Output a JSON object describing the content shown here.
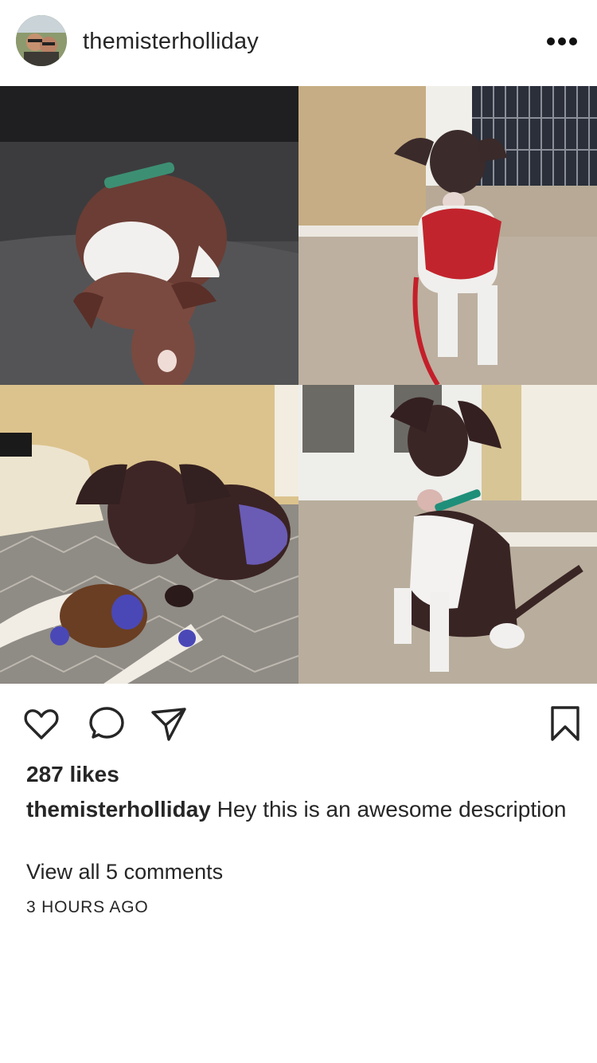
{
  "post": {
    "username": "themisterholliday",
    "more_icon": "ellipsis-icon",
    "likes_text": "287 likes",
    "caption_user": "themisterholliday",
    "caption_text": "Hey this is an awesome description",
    "view_comments_text": "View all 5 comments",
    "timestamp": "3 HOURS AGO"
  },
  "actions": {
    "like_icon": "heart-icon",
    "comment_icon": "comment-bubble-icon",
    "share_icon": "paper-plane-icon",
    "save_icon": "bookmark-icon"
  }
}
